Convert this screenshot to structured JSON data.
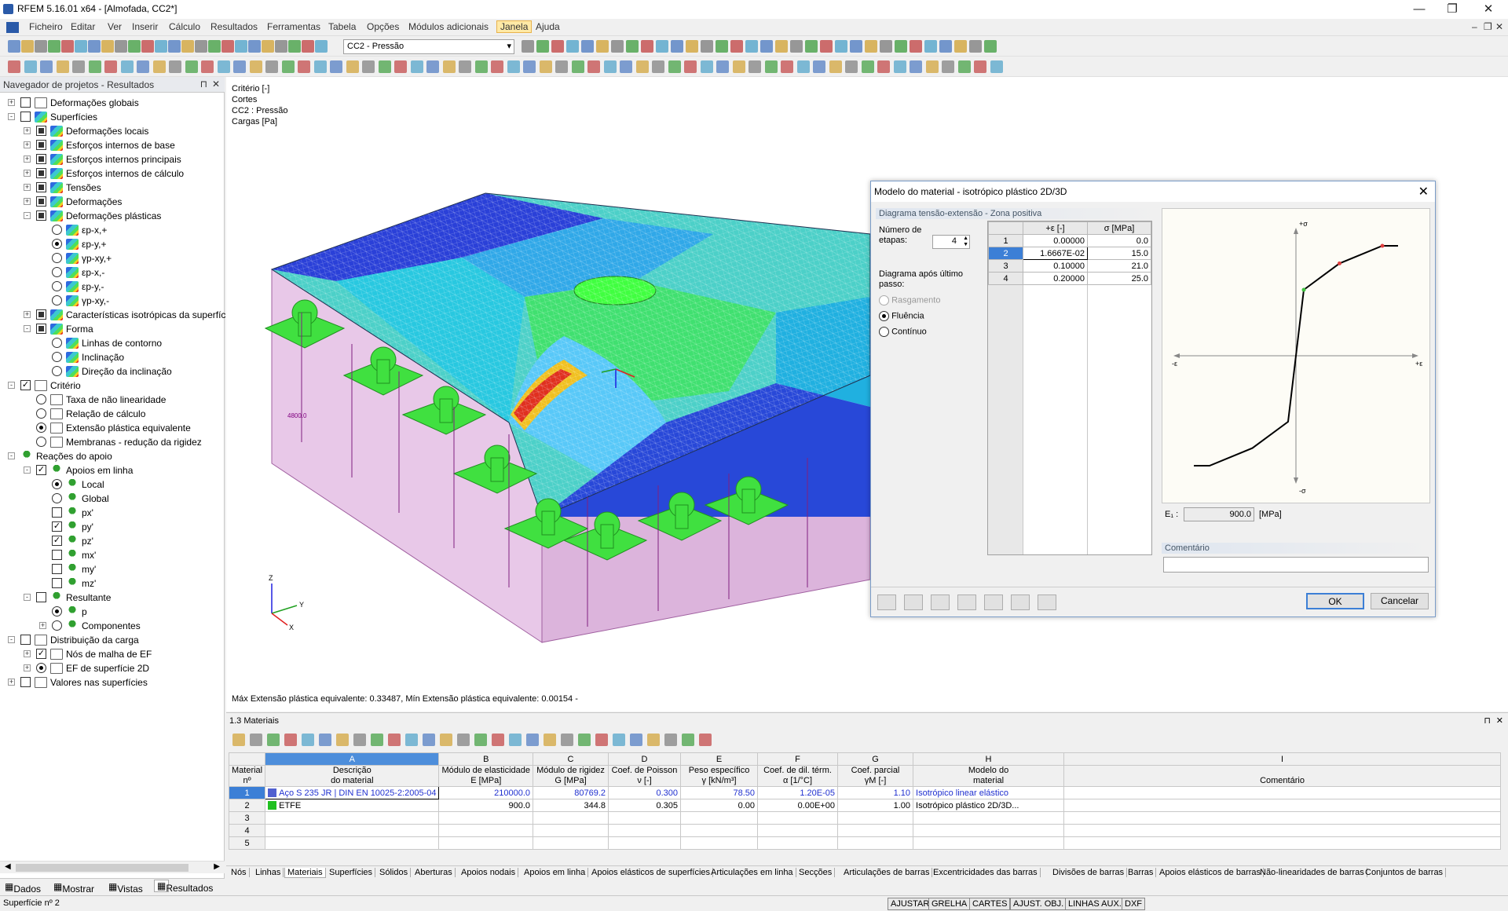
{
  "window": {
    "title": "RFEM 5.16.01 x64 - [Almofada, CC2*]"
  },
  "menu": [
    "Ficheiro",
    "Editar",
    "Ver",
    "Inserir",
    "Cálculo",
    "Resultados",
    "Ferramentas",
    "Tabela",
    "Opções",
    "Módulos adicionais",
    "Janela",
    "Ajuda"
  ],
  "toolbar": {
    "loadcase": "CC2 - Pressão"
  },
  "navigator": {
    "title": "Navegador de projetos - Resultados",
    "items": [
      {
        "label": "Deformações globais"
      },
      {
        "label": "Superfícies"
      },
      {
        "label": "Deformações locais"
      },
      {
        "label": "Esforços internos de base"
      },
      {
        "label": "Esforços internos principais"
      },
      {
        "label": "Esforços internos de cálculo"
      },
      {
        "label": "Tensões"
      },
      {
        "label": "Deformações"
      },
      {
        "label": "Deformações plásticas"
      },
      {
        "label": "εp-x,+"
      },
      {
        "label": "εp-y,+"
      },
      {
        "label": "γp-xy,+"
      },
      {
        "label": "εp-x,-"
      },
      {
        "label": "εp-y,-"
      },
      {
        "label": "γp-xy,-"
      },
      {
        "label": "Características isotrópicas da superfície"
      },
      {
        "label": "Forma"
      },
      {
        "label": "Linhas de contorno"
      },
      {
        "label": "Inclinação"
      },
      {
        "label": "Direção da inclinação"
      },
      {
        "label": "Critério"
      },
      {
        "label": "Taxa de não linearidade"
      },
      {
        "label": "Relação de cálculo"
      },
      {
        "label": "Extensão plástica equivalente"
      },
      {
        "label": "Membranas - redução da rigidez"
      },
      {
        "label": "Reações do apoio"
      },
      {
        "label": "Apoios em linha"
      },
      {
        "label": "Local"
      },
      {
        "label": "Global"
      },
      {
        "label": "px'"
      },
      {
        "label": "py'"
      },
      {
        "label": "pz'"
      },
      {
        "label": "mx'"
      },
      {
        "label": "my'"
      },
      {
        "label": "mz'"
      },
      {
        "label": "Resultante"
      },
      {
        "label": "p"
      },
      {
        "label": "Componentes"
      },
      {
        "label": "Distribuição da carga"
      },
      {
        "label": "Nós de malha de EF"
      },
      {
        "label": "EF de superfície 2D"
      },
      {
        "label": "Valores nas superfícies"
      }
    ],
    "tabs": [
      "Dados",
      "Mostrar",
      "Vistas",
      "Resultados"
    ]
  },
  "view": {
    "info": [
      "Critério [-]",
      "Cortes",
      "CC2 : Pressão",
      "Cargas [Pa]"
    ],
    "dim_label": "4800.0",
    "footer": "Máx Extensão plástica equivalente: 0.33487, Mín Extensão plástica equivalente: 0.00154 -",
    "axes": {
      "x": "X",
      "y": "Y",
      "z": "Z"
    }
  },
  "dialog": {
    "title": "Modelo do material - isotrópico plástico 2D/3D",
    "group": "Diagrama tensão-extensão - Zona positiva",
    "steps_label_1": "Número de",
    "steps_label_2": "etapas:",
    "steps_value": "4",
    "after_label_1": "Diagrama após último",
    "after_label_2": "passo:",
    "options": [
      "Rasgamento",
      "Fluência",
      "Contínuo"
    ],
    "col_eps": "+ε [-]",
    "col_sig": "σ [MPa]",
    "rows": [
      {
        "n": "1",
        "eps": "0.00000",
        "sig": "0.0"
      },
      {
        "n": "2",
        "eps": "1.6667E-02",
        "sig": "15.0"
      },
      {
        "n": "3",
        "eps": "0.10000",
        "sig": "21.0"
      },
      {
        "n": "4",
        "eps": "0.20000",
        "sig": "25.0"
      }
    ],
    "graph": {
      "sig_pos": "+σ",
      "sig_neg": "-σ",
      "eps_pos": "+ε",
      "eps_neg": "-ε"
    },
    "e_label": "E₁ :",
    "e_value": "900.0",
    "e_unit": "[MPa]",
    "comment_label": "Comentário",
    "ok": "OK",
    "cancel": "Cancelar"
  },
  "materials": {
    "title": "1.3 Materiais",
    "col_letters": [
      "A",
      "B",
      "C",
      "D",
      "E",
      "F",
      "G",
      "H",
      "I"
    ],
    "headers": [
      [
        "Material",
        "nº"
      ],
      [
        "Descrição",
        "do material"
      ],
      [
        "Módulo de elasticidade",
        "E [MPa]"
      ],
      [
        "Módulo de rigidez",
        "G [MPa]"
      ],
      [
        "Coef. de Poisson",
        "ν [-]"
      ],
      [
        "Peso específico",
        "γ [kN/m³]"
      ],
      [
        "Coef. de dil. térm.",
        "α [1/°C]"
      ],
      [
        "Coef. parcial",
        "γM [-]"
      ],
      [
        "Modelo do",
        "material"
      ],
      [
        "",
        "Comentário"
      ]
    ],
    "rows": [
      {
        "n": "1",
        "desc": "Aço S 235 JR | DIN EN 10025-2:2005-04",
        "E": "210000.0",
        "G": "80769.2",
        "nu": "0.300",
        "gamma": "78.50",
        "alpha": "1.20E-05",
        "gm": "1.10",
        "model": "Isotrópico linear elástico",
        "color": "#5060d0"
      },
      {
        "n": "2",
        "desc": "ETFE",
        "E": "900.0",
        "G": "344.8",
        "nu": "0.305",
        "gamma": "0.00",
        "alpha": "0.00E+00",
        "gm": "1.00",
        "model": "Isotrópico plástico 2D/3D...",
        "color": "#20c020"
      },
      {
        "n": "3"
      },
      {
        "n": "4"
      },
      {
        "n": "5"
      }
    ]
  },
  "sheet_tabs": [
    "Nós",
    "Linhas",
    "Materiais",
    "Superfícies",
    "Sólidos",
    "Aberturas",
    "Apoios nodais",
    "Apoios em linha",
    "Apoios elásticos de superfícies",
    "Articulações em linha",
    "Secções",
    "Articulações de barras",
    "Excentricidades das barras",
    "Divisões de barras",
    "Barras",
    "Apoios elásticos de barras",
    "Não-linearidades de barras",
    "Conjuntos de barras"
  ],
  "status": {
    "text": "Superfície nº 2",
    "buttons": [
      "AJUSTAR",
      "GRELHA",
      "CARTES",
      "AJUST. OBJ.",
      "LINHAS AUX.",
      "DXF"
    ]
  }
}
